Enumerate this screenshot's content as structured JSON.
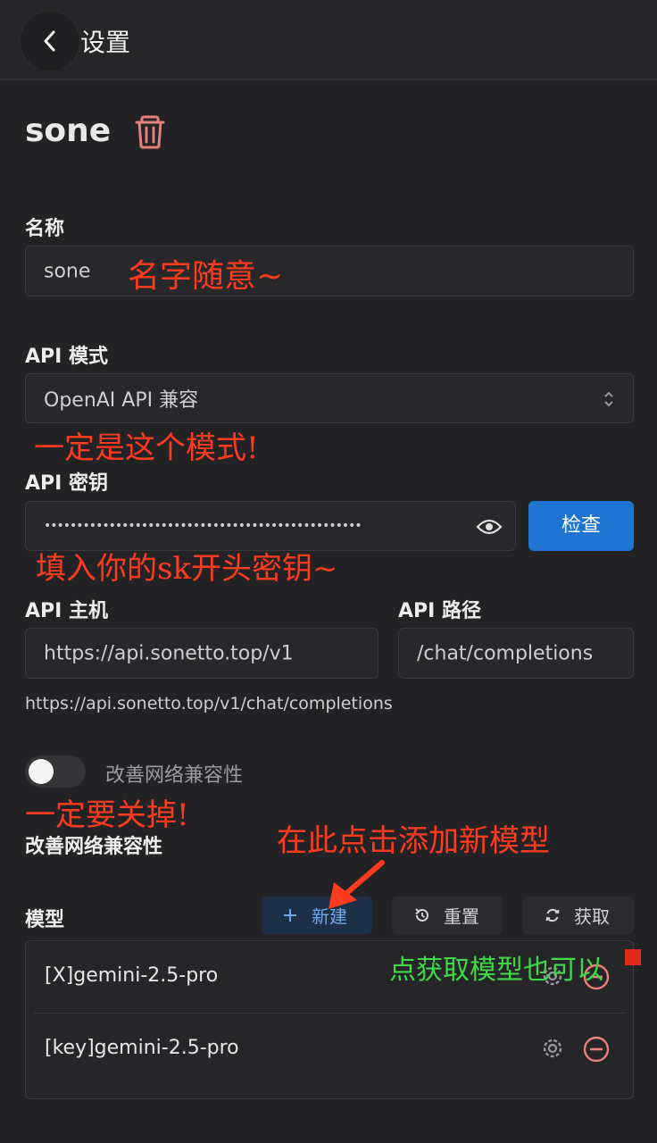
{
  "header": {
    "title": "设置"
  },
  "provider": {
    "name": "sone"
  },
  "name_field": {
    "label": "名称",
    "value": "sone",
    "annotation": "名字随意~"
  },
  "api_mode": {
    "label": "API 模式",
    "value": "OpenAI API 兼容",
    "annotation": "一定是这个模式!"
  },
  "api_key": {
    "label": "API 密钥",
    "value": "•••••••••••••••••••••••••••••••••••••••••••••••••",
    "check_label": "检查",
    "annotation": "填入你的sk开头密钥~"
  },
  "api_host": {
    "label": "API 主机",
    "value": "https://api.sonetto.top/v1"
  },
  "api_path": {
    "label": "API 路径",
    "value": "/chat/completions"
  },
  "full_url": "https://api.sonetto.top/v1/chat/completions",
  "network": {
    "toggle_label": "改善网络兼容性",
    "section_label": "改善网络兼容性",
    "annotation": "一定要关掉!",
    "enabled": false
  },
  "models": {
    "label": "模型",
    "new_label": "新建",
    "reset_label": "重置",
    "fetch_label": "获取",
    "annotation_new": "在此点击添加新模型",
    "annotation_fetch": "点获取模型也可以",
    "items": [
      {
        "name": "[X]gemini-2.5-pro"
      },
      {
        "name": "[key]gemini-2.5-pro"
      }
    ]
  },
  "colors": {
    "accent": "#1f74d2",
    "annotation_red": "#ff3b1f",
    "annotation_green": "#3fd94a",
    "danger": "#e6817c"
  }
}
